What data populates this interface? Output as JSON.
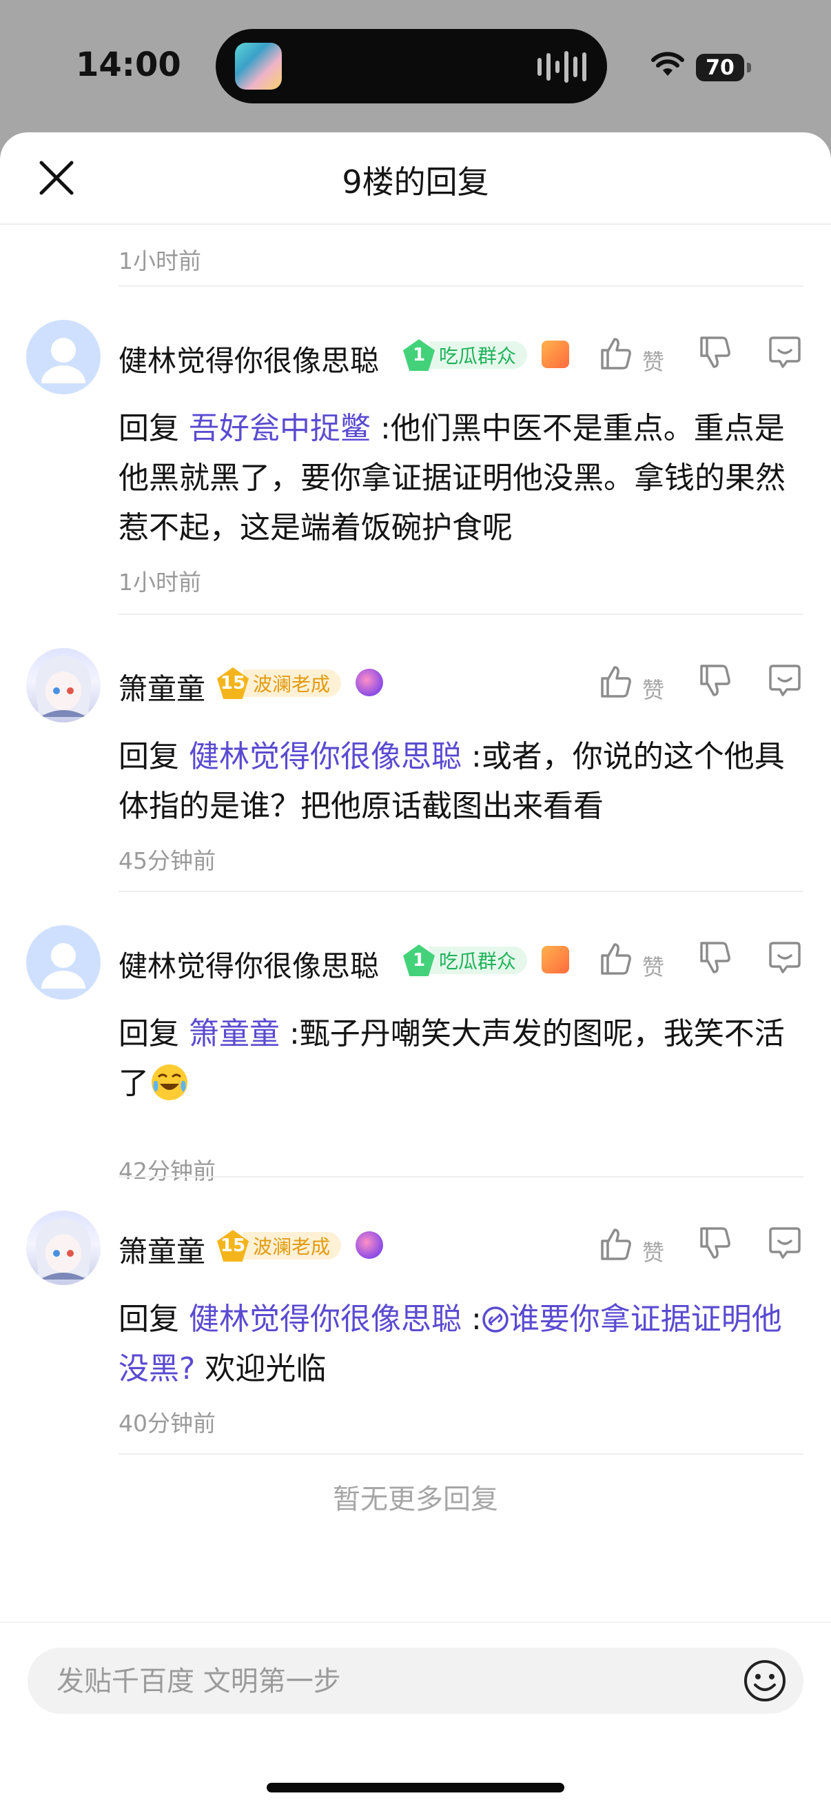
{
  "status_bar": {
    "time": "14:00",
    "battery": "70"
  },
  "sheet": {
    "title": "9楼的回复"
  },
  "top_time": "1小时前",
  "like_label": "赞",
  "replies": [
    {
      "username": "健林觉得你很像思聪",
      "level": "1",
      "badge": "吃瓜群众",
      "reply_prefix": "回复 ",
      "mention": "吾好瓮中捉鳖",
      "text": " :他们黑中医不是重点。重点是他黑就黑了，要你拿证据证明他没黑。拿钱的果然惹不起，这是端着饭碗护食呢",
      "time": "1小时前"
    },
    {
      "username": "箫童童",
      "level": "15",
      "badge": "波澜老成",
      "reply_prefix": "回复 ",
      "mention": "健林觉得你很像思聪",
      "text": " :或者，你说的这个他具体指的是谁？把他原话截图出来看看",
      "time": "45分钟前"
    },
    {
      "username": "健林觉得你很像思聪",
      "level": "1",
      "badge": "吃瓜群众",
      "reply_prefix": "回复 ",
      "mention": "箫童童",
      "text": " :甄子丹嘲笑大声发的图呢，我笑不活了",
      "time": "42分钟前"
    },
    {
      "username": "箫童童",
      "level": "15",
      "badge": "波澜老成",
      "reply_prefix": "回复 ",
      "mention": "健林觉得你很像思聪",
      "text_colon": " :",
      "link": "谁要你拿证据证明他没黑?",
      "text_after": "  欢迎光临",
      "time": "40分钟前"
    }
  ],
  "no_more": "暂无更多回复",
  "composer": {
    "placeholder": "发贴千百度 文明第一步"
  },
  "icons": {
    "close": "close-icon",
    "like": "thumbs-up-icon",
    "dislike": "thumbs-down-icon",
    "comment": "comment-icon",
    "emoji": "smile-icon",
    "link": "link-icon"
  },
  "colors": {
    "mention": "#5a4bd1",
    "badge_green": "#43d27a",
    "badge_gold": "#f4b51c"
  }
}
